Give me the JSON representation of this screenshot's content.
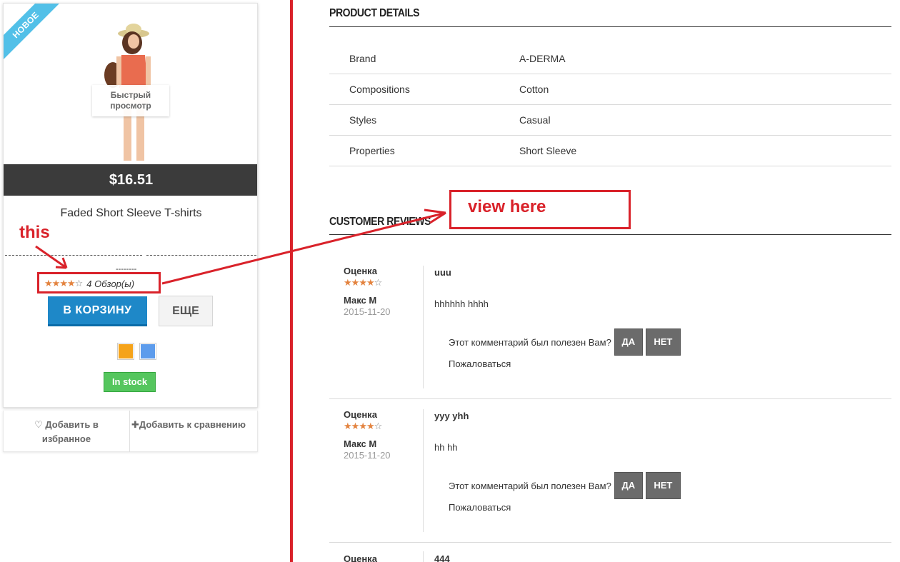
{
  "product_card": {
    "ribbon": "НОВОЕ",
    "quick_view_line1": "Быстрый",
    "quick_view_line2": "просмотр",
    "price": "$16.51",
    "name": "Faded Short Sleeve T-shirts",
    "dashes": "--------",
    "rating": 4,
    "rating_max": 5,
    "reviews_label": "4 Обзор(ы)",
    "cart_button": "В КОРЗИНУ",
    "more_button": "ЕЩЕ",
    "swatch_colors": [
      "#f5a31a",
      "#5d9cec"
    ],
    "stock": "In stock",
    "wishlist_line1": "Добавить в",
    "wishlist_line2": "избранное",
    "compare": "Добавить к сравнению"
  },
  "details": {
    "title": "PRODUCT DETAILS",
    "rows": [
      {
        "key": "Brand",
        "value": "A-DERMA"
      },
      {
        "key": "Compositions",
        "value": "Cotton"
      },
      {
        "key": "Styles",
        "value": "Casual"
      },
      {
        "key": "Properties",
        "value": "Short Sleeve"
      }
    ]
  },
  "reviews": {
    "title": "CUSTOMER REVIEWS",
    "rating_label": "Оценка",
    "useful_question": "Этот комментарий был полезен Вам?",
    "yes": "ДА",
    "no": "НЕТ",
    "report": "Пожаловаться",
    "items": [
      {
        "rating": 4,
        "author": "Макс М",
        "date": "2015-11-20",
        "title": "uuu",
        "body": "hhhhhh hhhh"
      },
      {
        "rating": 4,
        "author": "Макс М",
        "date": "2015-11-20",
        "title": "yyy yhh",
        "body": "hh hh"
      }
    ],
    "partial_label": "Оценка",
    "partial_title": "444"
  },
  "annotations": {
    "this_label": "this",
    "view_here_label": "view here",
    "color": "#d9222a"
  }
}
